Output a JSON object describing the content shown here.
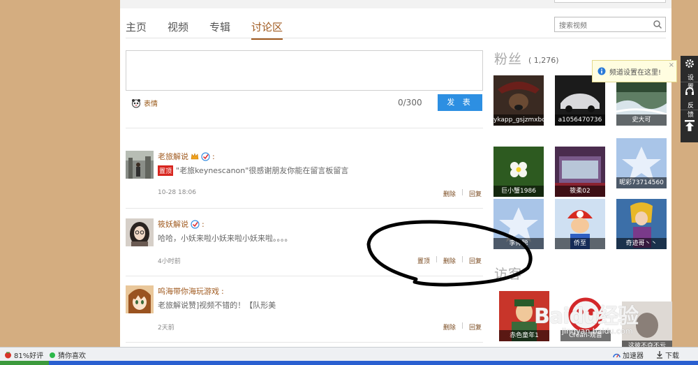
{
  "nav": {
    "tabs": [
      "主页",
      "视频",
      "专辑",
      "讨论区"
    ],
    "active_tab": 3
  },
  "search": {
    "placeholder": "搜索视频"
  },
  "composer": {
    "emoji_label": "表情",
    "counter": "0/300",
    "post_label": "发 表"
  },
  "comments": [
    {
      "name": "老旅解说",
      "pinned_badge": "置顶",
      "text": "\"老旅keynescanon\"很感谢朋友你能在留言板留言",
      "time": "10-28 18:06",
      "actions": [
        "删除",
        "回复"
      ]
    },
    {
      "name": "筱妖解说",
      "text": "哈哈，小妖来啦小妖来啦小妖来啦。。。。",
      "time": "4小时前",
      "actions": [
        "置顶",
        "删除",
        "回复"
      ]
    },
    {
      "name": "呜海带你海玩游戏",
      "text": "老旅解说赞]视频不错的！【队形美",
      "time": "2天前",
      "actions": [
        "删除",
        "回复"
      ]
    }
  ],
  "fans": {
    "title": "粉丝",
    "count": "( 1,276)",
    "items": [
      "ykapp_gsjzmxbc",
      "a1056470736",
      "史大可",
      "巨小蟹1986",
      "筱柔02",
      "昵彩73714560",
      "李帅聪",
      "侨至",
      "奇迹哥丶丶"
    ]
  },
  "visitors": {
    "title": "访客",
    "items": [
      "赤色童年1",
      "Crean-观音",
      "这彼不夺不亏"
    ]
  },
  "tooltip": {
    "text": "频道设置在这里!",
    "close": "×"
  },
  "side_tools": {
    "settings": "设置",
    "feedback": "反馈"
  },
  "watermark": {
    "big": "Baidu经验",
    "small": "jingyan.baidu.com"
  },
  "statusbar": {
    "rating": "81%好评",
    "guess": "猜你喜欢",
    "accelerator": "加速器",
    "download": "下载"
  },
  "colors": {
    "accent": "#a05a1f",
    "post_button": "#2d8fe2",
    "pinned": "#d8261f",
    "page_bg": "#d4ad80"
  }
}
